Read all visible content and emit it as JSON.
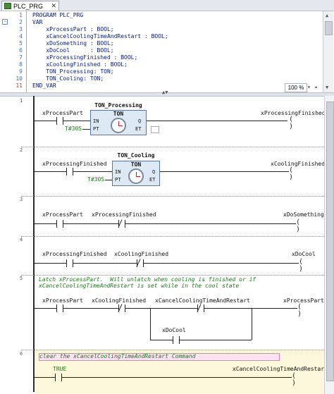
{
  "tab": {
    "icon": "pou-icon",
    "title": "PLC_PRG",
    "close": "✕"
  },
  "declaration": {
    "lines": [
      {
        "n": "1",
        "text": "PROGRAM PLC_PRG"
      },
      {
        "n": "2",
        "text": "VAR"
      },
      {
        "n": "3",
        "text": "    xProcessPart : BOOL;"
      },
      {
        "n": "4",
        "text": "    xCancelCoolingTimeAndRestart : BOOL;"
      },
      {
        "n": "5",
        "text": "    xDoSomething : BOOL;"
      },
      {
        "n": "6",
        "text": "    xDoCool      : BOOL;"
      },
      {
        "n": "7",
        "text": "    xProcessingFinished : BOOL;"
      },
      {
        "n": "8",
        "text": "    xCoolingFinished : BOOL;"
      },
      {
        "n": "9",
        "text": "    TON_Processing: TON;"
      },
      {
        "n": "10",
        "text": "    TON_Cooling: TON;"
      },
      {
        "n": "11",
        "text": "END_VAR"
      }
    ],
    "zoom": "100 %"
  },
  "networks": [
    {
      "n": "1",
      "fb_instance": "TON_Processing",
      "fb_type": "TON",
      "in_var": "xProcessPart",
      "pt_value": "T#30S",
      "out_var": "xProcessingFinished",
      "pins": {
        "in": "IN",
        "pt": "PT",
        "q": "Q",
        "et": "ET"
      }
    },
    {
      "n": "2",
      "fb_instance": "TON_Cooling",
      "fb_type": "TON",
      "in_var": "xProcessingFinished",
      "pt_value": "T#30S",
      "out_var": "xCoolingFinished",
      "pins": {
        "in": "IN",
        "pt": "PT",
        "q": "Q",
        "et": "ET"
      }
    },
    {
      "n": "3",
      "c1": "xProcessPart",
      "c2": "xProcessingFinished",
      "coil": "xDoSomething"
    },
    {
      "n": "4",
      "c1": "xProcessingFinished",
      "c2": "xCoolingFinished",
      "coil": "xDoCool"
    },
    {
      "n": "5",
      "comment1": "Latch xProcessPart.  Will unlatch when cooling is finished or if",
      "comment2": "xCancelCoolingTimeAndRestart is set while in the cool state",
      "c1": "xProcessPart",
      "c2": "xCoolingFinished",
      "c3": "xCancelCoolingTimeAndRestart",
      "branch": "xDoCool",
      "coil": "xProcessPart"
    },
    {
      "n": "6",
      "comment": "clear the xCancelCoolingTimeAndRestart Command",
      "contact_value": "TRUE",
      "coil": "xCancelCoolingTimeAndRestart"
    }
  ],
  "colors": {
    "keyword": "#001a80",
    "comment": "#1a7a1a",
    "fb_fill": "#dde8f5",
    "net6_bg": "#fdf8dc"
  }
}
